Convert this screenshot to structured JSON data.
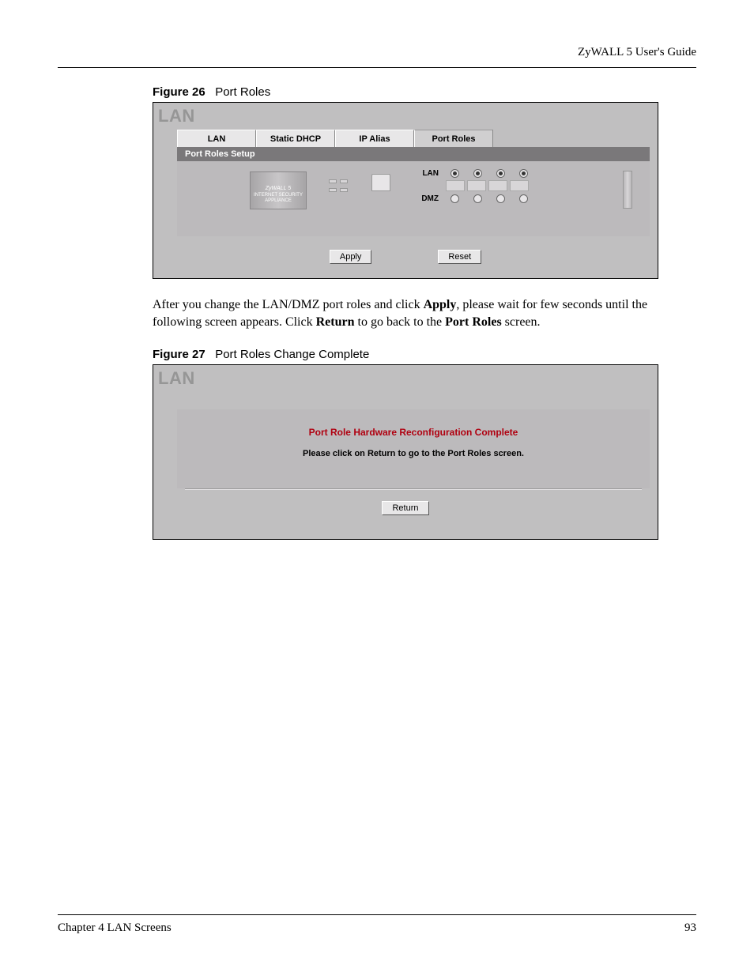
{
  "header": {
    "guide_title": "ZyWALL 5 User's Guide"
  },
  "figure26": {
    "caption_label": "Figure 26",
    "caption_text": "Port Roles",
    "screen_title": "LAN",
    "tabs": {
      "lan": "LAN",
      "static_dhcp": "Static DHCP",
      "ip_alias": "IP Alias",
      "port_roles": "Port Roles"
    },
    "panel_title": "Port Roles Setup",
    "device_brand": "ZyWALL  5",
    "device_sub": "INTERNET SECURITY APPLIANCE",
    "row_lan": "LAN",
    "row_dmz": "DMZ",
    "buttons": {
      "apply": "Apply",
      "reset": "Reset"
    }
  },
  "paragraph": {
    "pre": "After you change the LAN/DMZ port roles and click ",
    "bold1": "Apply",
    "mid1": ", please wait for few seconds until the following screen appears. Click ",
    "bold2": "Return",
    "mid2": " to go back to the ",
    "bold3": "Port Roles",
    "post": " screen."
  },
  "figure27": {
    "caption_label": "Figure 27",
    "caption_text": "Port Roles Change Complete",
    "screen_title": "LAN",
    "msg_title": "Port Role Hardware Reconfiguration Complete",
    "msg_sub": "Please click on Return to go to the Port Roles screen.",
    "button_return": "Return"
  },
  "footer": {
    "chapter": "Chapter 4 LAN Screens",
    "page": "93"
  }
}
